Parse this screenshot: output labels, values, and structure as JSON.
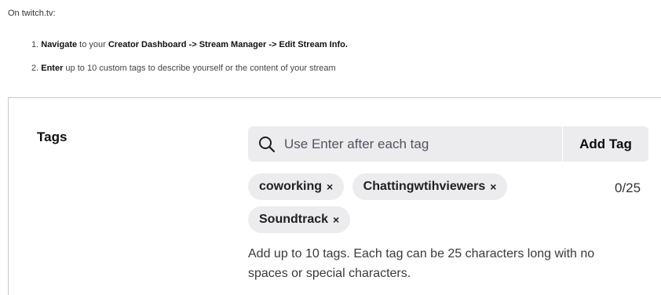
{
  "intro": "On twitch.tv:",
  "steps": [
    {
      "num": "1.",
      "verb": "Navigate",
      "text": " to your ",
      "path": "Creator Dashboard -> Stream Manager -> Edit Stream Info."
    },
    {
      "num": "2.",
      "verb": "Enter",
      "text": " up to 10 custom tags to describe yourself or the content of your stream"
    }
  ],
  "tags_panel": {
    "label": "Tags",
    "search": {
      "placeholder": "Use Enter after each tag",
      "value": "",
      "icon": "search-icon"
    },
    "add_button": "Add Tag",
    "counter": "0/25",
    "chips": [
      {
        "label": "coworking",
        "remove": "×"
      },
      {
        "label": "Chattingwtihviewers",
        "remove": "×"
      },
      {
        "label": "Soundtrack",
        "remove": "×"
      }
    ],
    "help_text": "Add up to 10 tags. Each tag can be 25 characters long with no spaces or special characters."
  }
}
